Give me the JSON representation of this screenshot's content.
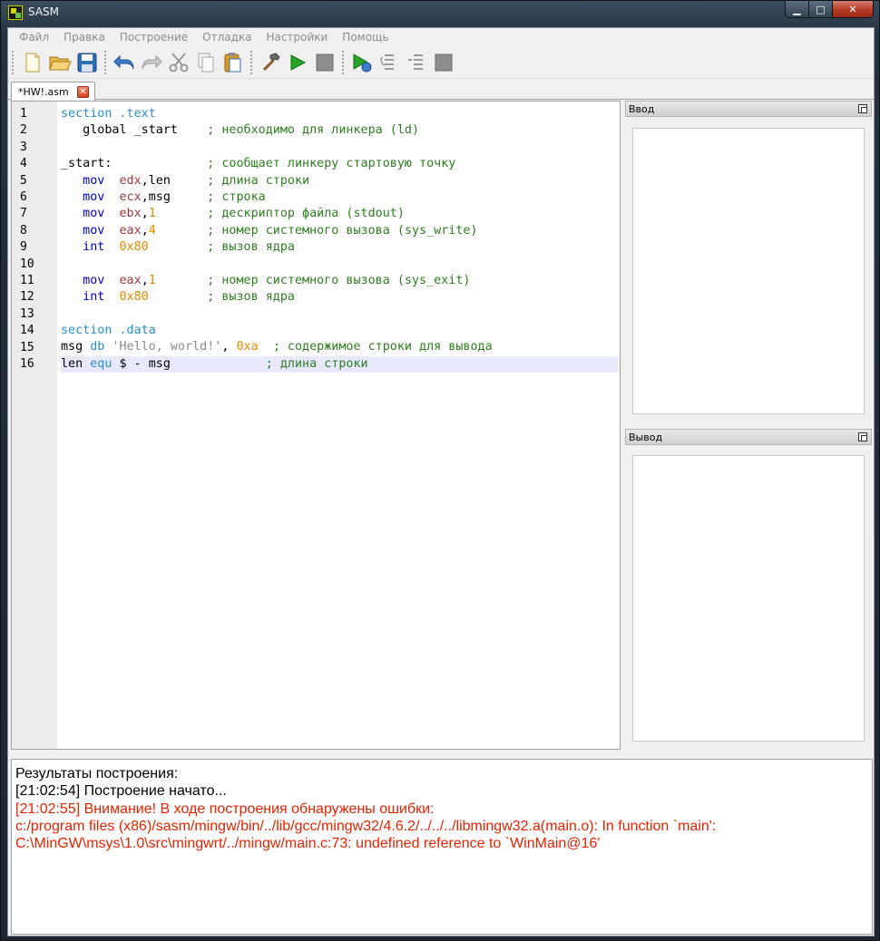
{
  "window": {
    "title": "SASM",
    "minimize": "▁",
    "maximize": "□",
    "close": "✕"
  },
  "menu": [
    "Файл",
    "Правка",
    "Построение",
    "Отладка",
    "Настройки",
    "Помощь"
  ],
  "toolbar": {
    "buttons": [
      "new-file-icon",
      "open-folder-icon",
      "save-icon",
      "undo-icon",
      "redo-icon",
      "cut-icon",
      "copy-icon",
      "paste-icon",
      "build-hammer-icon",
      "run-icon",
      "stop-icon",
      "debug-icon",
      "step-over-icon",
      "step-into-icon",
      "stop-debug-icon"
    ]
  },
  "tabs": [
    {
      "label": "*HW!.asm",
      "active": true
    }
  ],
  "editor": {
    "line_numbers": [
      "1",
      "2",
      "3",
      "4",
      "5",
      "6",
      "7",
      "8",
      "9",
      "10",
      "11",
      "12",
      "13",
      "14",
      "15",
      "16"
    ],
    "current_line": 16,
    "lines": [
      [
        {
          "t": "section .text",
          "c": "sec"
        }
      ],
      [
        {
          "t": "   global _start    ",
          "c": "plain",
          "pre": "   "
        },
        {
          "t": "; необходимо для линкера (ld)",
          "c": "cmt"
        }
      ],
      [],
      [
        {
          "t": "_start:             ",
          "c": "plain"
        },
        {
          "t": "; сообщает линкеру стартовую точку",
          "c": "cmt"
        }
      ],
      [
        {
          "t": "   mov  ",
          "c": "kw"
        },
        {
          "t": "edx",
          "c": "reg"
        },
        {
          "t": ",len     ",
          "c": "plain"
        },
        {
          "t": "; длина строки",
          "c": "cmt"
        }
      ],
      [
        {
          "t": "   mov  ",
          "c": "kw"
        },
        {
          "t": "ecx",
          "c": "reg"
        },
        {
          "t": ",msg     ",
          "c": "plain"
        },
        {
          "t": "; строка",
          "c": "cmt"
        }
      ],
      [
        {
          "t": "   mov  ",
          "c": "kw"
        },
        {
          "t": "ebx",
          "c": "reg"
        },
        {
          "t": ",",
          "c": "plain"
        },
        {
          "t": "1",
          "c": "num"
        },
        {
          "t": "       ",
          "c": "plain"
        },
        {
          "t": "; дескриптор файла (stdout)",
          "c": "cmt"
        }
      ],
      [
        {
          "t": "   mov  ",
          "c": "kw"
        },
        {
          "t": "eax",
          "c": "reg"
        },
        {
          "t": ",",
          "c": "plain"
        },
        {
          "t": "4",
          "c": "num"
        },
        {
          "t": "       ",
          "c": "plain"
        },
        {
          "t": "; номер системного вызова (sys_write)",
          "c": "cmt"
        }
      ],
      [
        {
          "t": "   int  ",
          "c": "kw"
        },
        {
          "t": "0x80",
          "c": "num"
        },
        {
          "t": "        ",
          "c": "plain"
        },
        {
          "t": "; вызов ядра",
          "c": "cmt"
        }
      ],
      [],
      [
        {
          "t": "   mov  ",
          "c": "kw"
        },
        {
          "t": "eax",
          "c": "reg"
        },
        {
          "t": ",",
          "c": "plain"
        },
        {
          "t": "1",
          "c": "num"
        },
        {
          "t": "       ",
          "c": "plain"
        },
        {
          "t": "; номер системного вызова (sys_exit)",
          "c": "cmt"
        }
      ],
      [
        {
          "t": "   int  ",
          "c": "kw"
        },
        {
          "t": "0x80",
          "c": "num"
        },
        {
          "t": "        ",
          "c": "plain"
        },
        {
          "t": "; вызов ядра",
          "c": "cmt"
        }
      ],
      [],
      [
        {
          "t": "section .data",
          "c": "sec"
        }
      ],
      [
        {
          "t": "msg ",
          "c": "plain"
        },
        {
          "t": "db",
          "c": "sec"
        },
        {
          "t": " ",
          "c": "plain"
        },
        {
          "t": "'Hello, world!'",
          "c": "str"
        },
        {
          "t": ", ",
          "c": "plain"
        },
        {
          "t": "0xa",
          "c": "num"
        },
        {
          "t": "  ",
          "c": "plain"
        },
        {
          "t": "; содержимое строки для вывода",
          "c": "cmt"
        }
      ],
      [
        {
          "t": "len ",
          "c": "plain"
        },
        {
          "t": "equ",
          "c": "sec"
        },
        {
          "t": " $ - msg             ",
          "c": "plain"
        },
        {
          "t": "; длина строки",
          "c": "cmt"
        }
      ]
    ]
  },
  "input_dock": {
    "title": "Ввод"
  },
  "output_dock": {
    "title": "Вывод"
  },
  "build_log": {
    "lines": [
      {
        "text": "Результаты построения:",
        "kind": "ok"
      },
      {
        "text": "[21:02:54] Построение начато...",
        "kind": "ok"
      },
      {
        "text": "[21:02:55] Внимание! В ходе построения обнаружены ошибки:",
        "kind": "err"
      },
      {
        "text": "c:/program files (x86)/sasm/mingw/bin/../lib/gcc/mingw32/4.6.2/../../../libmingw32.a(main.o): In function `main':",
        "kind": "err"
      },
      {
        "text": "C:\\MinGW\\msys\\1.0\\src\\mingwrt/../mingw/main.c:73: undefined reference to `WinMain@16'",
        "kind": "err"
      }
    ]
  },
  "colors": {
    "keyword": "#0000c8",
    "section": "#2a8fc4",
    "register": "#9b3a3a",
    "number": "#e08a00",
    "comment": "#2e7d1f",
    "string": "#8a8a8a",
    "error": "#e32400"
  }
}
